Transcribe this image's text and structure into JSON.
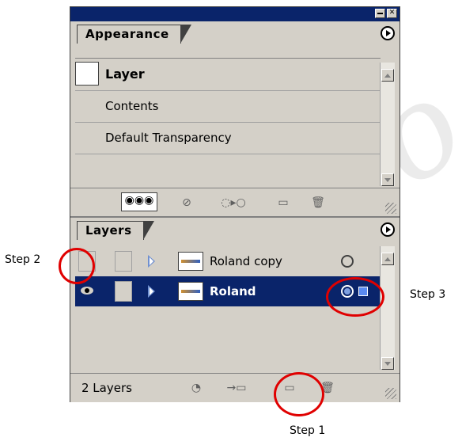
{
  "appearance": {
    "tab_label": "Appearance",
    "rows": [
      {
        "label": "Layer"
      },
      {
        "label": "Contents"
      },
      {
        "label": "Default Transparency"
      }
    ]
  },
  "layers": {
    "tab_label": "Layers",
    "items": [
      {
        "name": "Roland copy",
        "selected": false,
        "visible": false
      },
      {
        "name": "Roland",
        "selected": true,
        "visible": true
      }
    ],
    "count_label": "2 Layers"
  },
  "annotations": {
    "step1": "Step 1",
    "step2": "Step 2",
    "step3": "Step 3"
  },
  "colors": {
    "titlebar": "#0a246a",
    "selection": "#0a246a",
    "annotation_ring": "#e00000",
    "panel_bg": "#d4d0c8"
  },
  "icons": {
    "appearance_footer": [
      "duplicate-style-icon",
      "clear-appearance-icon",
      "reduce-to-basic-icon",
      "new-item-icon",
      "trash-icon"
    ],
    "layers_footer": [
      "make-clipping-mask-icon",
      "new-sublayer-icon",
      "new-layer-icon",
      "trash-icon"
    ]
  }
}
